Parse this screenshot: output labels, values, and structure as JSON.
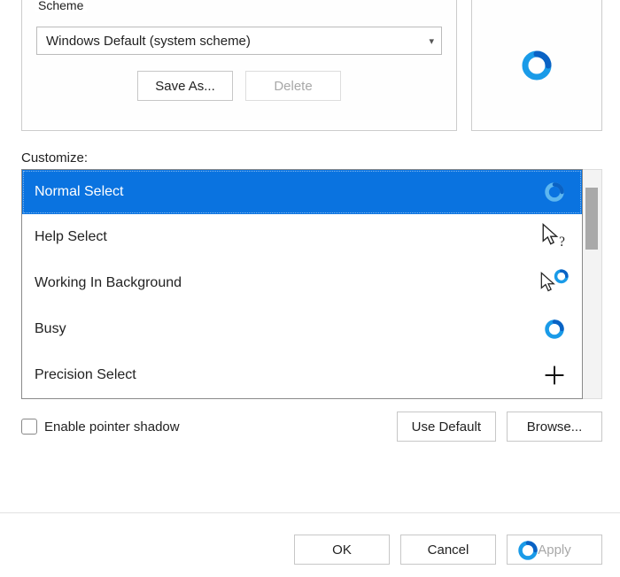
{
  "scheme": {
    "group_label": "Scheme",
    "selected": "Windows Default (system scheme)",
    "save_as": "Save As...",
    "delete": "Delete"
  },
  "customize_label": "Customize:",
  "cursor_list": [
    {
      "label": "Normal Select",
      "icon": "busy-ring",
      "selected": true
    },
    {
      "label": "Help Select",
      "icon": "arrow-help",
      "selected": false
    },
    {
      "label": "Working In Background",
      "icon": "arrow-busy",
      "selected": false
    },
    {
      "label": "Busy",
      "icon": "busy-ring",
      "selected": false
    },
    {
      "label": "Precision Select",
      "icon": "crosshair",
      "selected": false
    }
  ],
  "pointer_shadow": {
    "label": "Enable pointer shadow",
    "checked": false
  },
  "buttons": {
    "use_default": "Use Default",
    "browse": "Browse...",
    "ok": "OK",
    "cancel": "Cancel",
    "apply": "Apply"
  }
}
